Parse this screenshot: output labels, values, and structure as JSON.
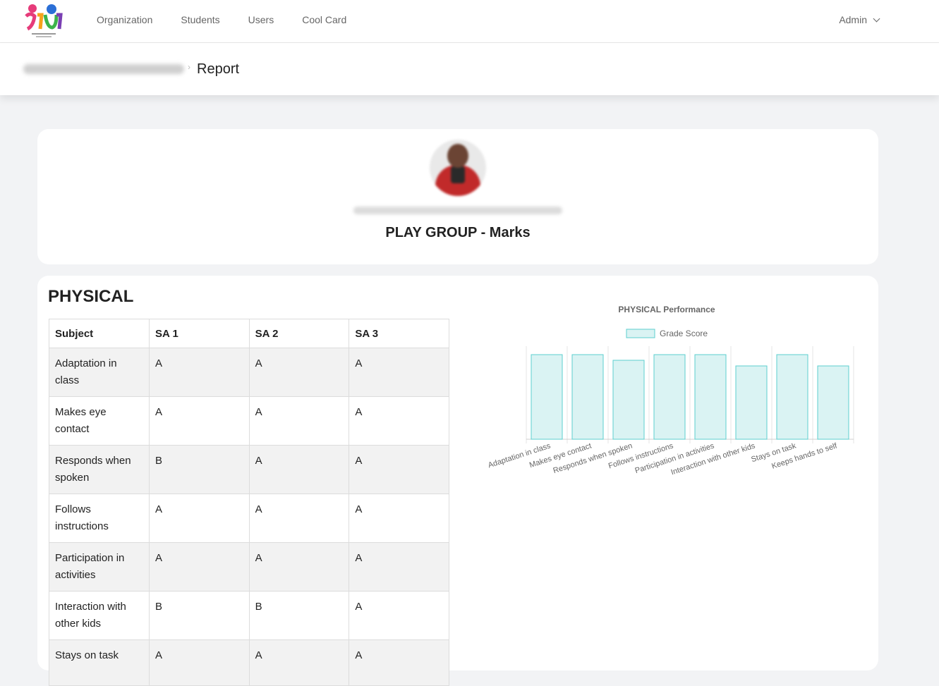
{
  "nav": {
    "items": [
      "Organization",
      "Students",
      "Users",
      "Cool Card"
    ],
    "user": "Admin"
  },
  "breadcrumb": {
    "current": "Report"
  },
  "profile": {
    "class_title": "PLAY GROUP - Marks"
  },
  "section": {
    "title": "PHYSICAL",
    "table": {
      "headers": [
        "Subject",
        "SA 1",
        "SA 2",
        "SA 3"
      ],
      "rows": [
        {
          "subject": "Adaptation in class",
          "sa1": "A",
          "sa2": "A",
          "sa3": "A"
        },
        {
          "subject": "Makes eye contact",
          "sa1": "A",
          "sa2": "A",
          "sa3": "A"
        },
        {
          "subject": "Responds when spoken",
          "sa1": "B",
          "sa2": "A",
          "sa3": "A"
        },
        {
          "subject": "Follows instructions",
          "sa1": "A",
          "sa2": "A",
          "sa3": "A"
        },
        {
          "subject": "Participation in activities",
          "sa1": "A",
          "sa2": "A",
          "sa3": "A"
        },
        {
          "subject": "Interaction with other kids",
          "sa1": "B",
          "sa2": "B",
          "sa3": "A"
        },
        {
          "subject": "Stays on task",
          "sa1": "A",
          "sa2": "A",
          "sa3": "A"
        }
      ]
    }
  },
  "chart_data": {
    "type": "bar",
    "title": "PHYSICAL Performance",
    "legend": "Grade Score",
    "legend_position": "top",
    "grid": true,
    "categories": [
      "Adaptation in class",
      "Makes eye contact",
      "Responds when spoken",
      "Follows instructions",
      "Participation in activities",
      "Interaction with other kids",
      "Stays on task",
      "Keeps hands to self"
    ],
    "values": [
      3,
      3,
      2.8,
      3,
      3,
      2.6,
      3,
      2.6
    ],
    "ylim": [
      0,
      3.3
    ],
    "colors": {
      "fill": "#daf3f3",
      "stroke": "#5ccfcf",
      "grid": "#e4e4e4"
    }
  }
}
